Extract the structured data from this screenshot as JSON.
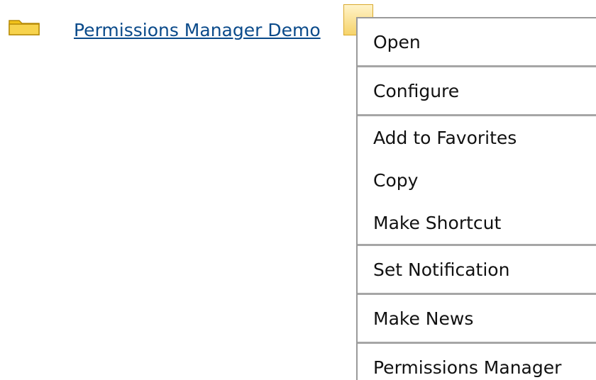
{
  "item": {
    "link_label": "Permissions Manager Demo",
    "icon": "folder-icon"
  },
  "menu": {
    "trigger_icon": "menu-trigger-icon",
    "items": [
      {
        "label": "Open"
      },
      {
        "label": "Configure"
      },
      {
        "label": "Add to Favorites"
      },
      {
        "label": "Copy"
      },
      {
        "label": "Make Shortcut"
      },
      {
        "label": "Set Notification"
      },
      {
        "label": "Make News"
      },
      {
        "label": "Permissions Manager"
      }
    ]
  },
  "colors": {
    "link": "#0a4a8a",
    "folder": "#f2c21a",
    "divider": "#a6a6a6"
  }
}
